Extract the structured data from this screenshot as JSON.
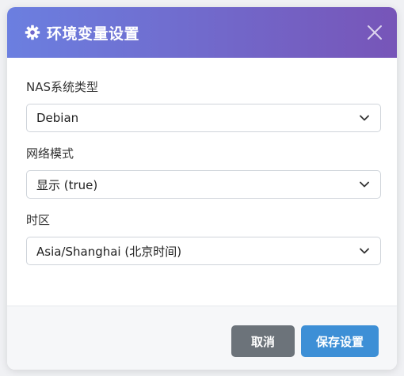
{
  "dialog": {
    "title": "环境变量设置",
    "fields": [
      {
        "label": "NAS系统类型",
        "value": "Debian"
      },
      {
        "label": "网络模式",
        "value": "显示 (true)"
      },
      {
        "label": "时区",
        "value": "Asia/Shanghai (北京时间)"
      }
    ],
    "buttons": {
      "cancel": "取消",
      "save": "保存设置"
    }
  },
  "colors": {
    "header_gradient_start": "#6b7fe0",
    "header_gradient_end": "#7755b8",
    "cancel_button": "#6c737a",
    "save_button": "#3d8fd6"
  },
  "icons": {
    "header": "gear-icon",
    "close": "close-icon",
    "select": "chevron-down-icon"
  }
}
